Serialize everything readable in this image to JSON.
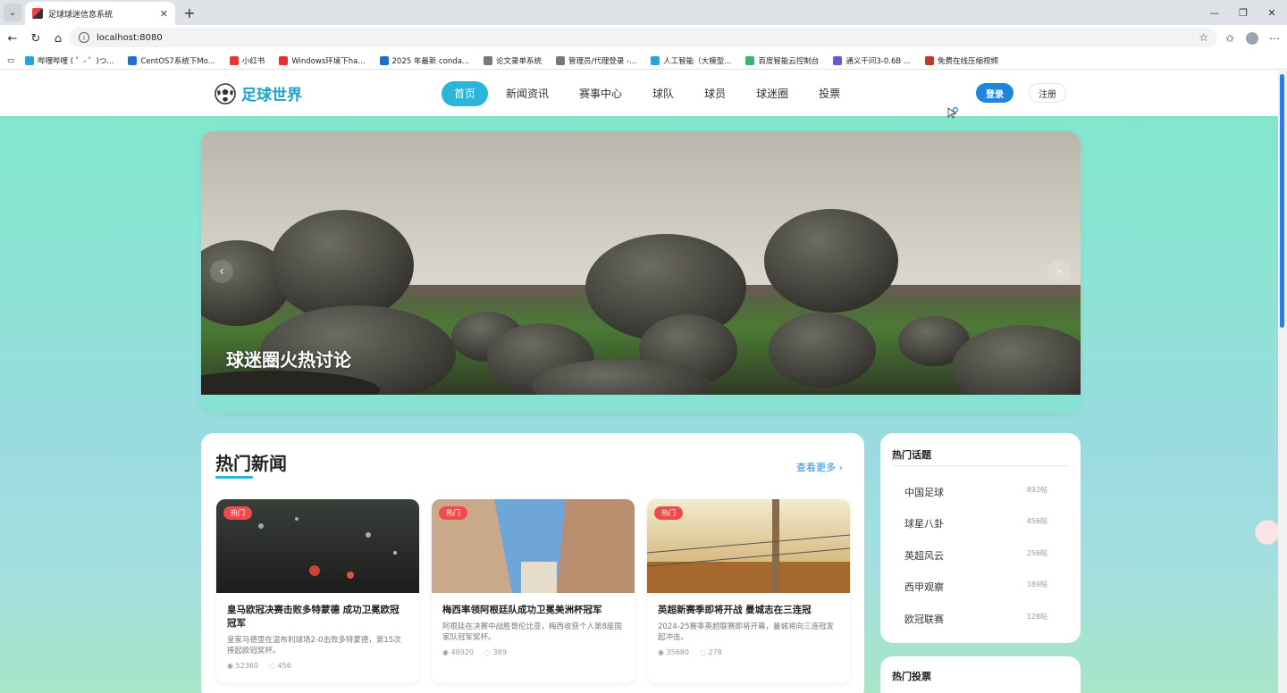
{
  "browser": {
    "tab_title": "足球球迷信息系统",
    "url": "localhost:8080",
    "bookmarks": [
      {
        "label": "哔哩哔哩 ( ゜- ゜)つ...",
        "color": "#29a3e0"
      },
      {
        "label": "CentOS7系统下Mo...",
        "color": "#1f6fd1"
      },
      {
        "label": "小红书",
        "color": "#e33"
      },
      {
        "label": "Windows环境下ha...",
        "color": "#d33"
      },
      {
        "label": "2025 年最新 conda...",
        "color": "#1f6fd1"
      },
      {
        "label": "论文录单系统",
        "color": "#777"
      },
      {
        "label": "管理员/代理登录 -...",
        "color": "#777"
      },
      {
        "label": "人工智能（大模型...",
        "color": "#29a3e0"
      },
      {
        "label": "百度智能云控制台",
        "color": "#3cb371"
      },
      {
        "label": "通义千问3-0.6B ...",
        "color": "#6a5acd"
      },
      {
        "label": "免费在线压缩视频",
        "color": "#c0392b"
      }
    ]
  },
  "site": {
    "logo": "足球世界",
    "nav": [
      "首页",
      "新闻资讯",
      "赛事中心",
      "球队",
      "球员",
      "球迷圈",
      "投票"
    ],
    "login": "登录",
    "register": "注册"
  },
  "banner": {
    "caption": "球迷圈火热讨论",
    "prev": "‹",
    "next": "›"
  },
  "news": {
    "title": "热门新闻",
    "more": "查看更多 ›",
    "items": [
      {
        "tag": "热门",
        "title": "皇马欧冠决赛击败多特蒙德 成功卫冕欧冠冠军",
        "desc": "皇家马德里在温布利球场2-0击败多特蒙德，第15次捧起欧冠奖杯。",
        "views": "52360",
        "comments": "456"
      },
      {
        "tag": "热门",
        "title": "梅西率领阿根廷队成功卫冕美洲杯冠军",
        "desc": "阿根廷在决赛中战胜哥伦比亚，梅西收获个人第8座国家队冠军奖杯。",
        "views": "48920",
        "comments": "389"
      },
      {
        "tag": "热门",
        "title": "英超新赛季即将开战 曼城志在三连冠",
        "desc": "2024-25赛季英超联赛即将开幕，曼城将向三连冠发起冲击。",
        "views": "35680",
        "comments": "278"
      }
    ]
  },
  "topics": {
    "title": "热门话题",
    "items": [
      {
        "name": "中国足球",
        "count": "892帖"
      },
      {
        "name": "球星八卦",
        "count": "456帖"
      },
      {
        "name": "英超风云",
        "count": "256帖"
      },
      {
        "name": "西甲观察",
        "count": "189帖"
      },
      {
        "name": "欧冠联赛",
        "count": "128帖"
      }
    ]
  },
  "votes": {
    "title": "热门投票"
  },
  "icons": {
    "eye": "eye-icon",
    "comment": "comment-icon"
  }
}
